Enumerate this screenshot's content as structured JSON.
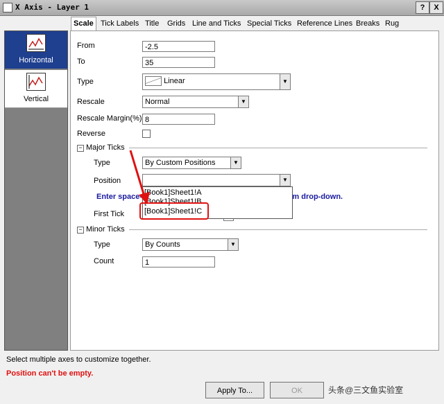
{
  "window": {
    "title": "X Axis - Layer 1",
    "help_label": "?",
    "close_label": "X"
  },
  "nav": {
    "items": [
      {
        "label": "Horizontal"
      },
      {
        "label": "Vertical"
      }
    ]
  },
  "tabs": [
    {
      "label": "Scale"
    },
    {
      "label": "Tick Labels"
    },
    {
      "label": "Title"
    },
    {
      "label": "Grids"
    },
    {
      "label": "Line and Ticks"
    },
    {
      "label": "Special Ticks"
    },
    {
      "label": "Reference Lines"
    },
    {
      "label": "Breaks"
    },
    {
      "label": "Rug"
    }
  ],
  "scale": {
    "from_label": "From",
    "from_value": "-2.5",
    "to_label": "To",
    "to_value": "35",
    "type_label": "Type",
    "type_value": "Linear",
    "rescale_label": "Rescale",
    "rescale_value": "Normal",
    "margin_label": "Rescale Margin(%)",
    "margin_value": "8",
    "reverse_label": "Reverse"
  },
  "major_ticks": {
    "header": "Major Ticks",
    "toggle": "−",
    "type_label": "Type",
    "type_value": "By Custom Positions",
    "position_label": "Position",
    "position_value": "",
    "hint_left": "Enter space-",
    "hint_right": "t from drop-down.",
    "first_tick_label": "First Tick",
    "options": [
      "[Book1]Sheet1!A",
      "[Book1]Sheet1!B",
      "[Book1]Sheet1!C"
    ]
  },
  "minor_ticks": {
    "header": "Minor Ticks",
    "toggle": "−",
    "type_label": "Type",
    "type_value": "By Counts",
    "count_label": "Count",
    "count_value": "1"
  },
  "status": {
    "message": "Select multiple axes to customize together.",
    "error": "Position can't be empty."
  },
  "buttons": {
    "apply_to": "Apply To...",
    "ok": "OK"
  },
  "watermark": "头条@三文鱼实验室",
  "colors": {
    "selected_nav": "#1f3f8f",
    "highlight": "#e01010",
    "hint": "#1a1aa0"
  }
}
